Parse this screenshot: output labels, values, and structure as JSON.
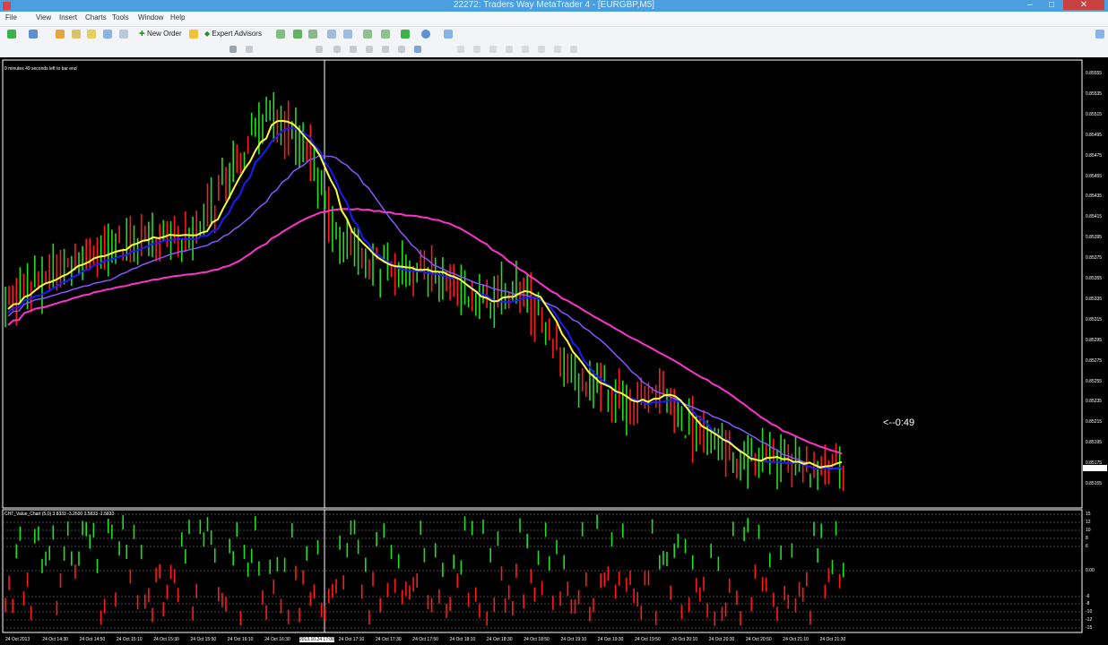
{
  "window": {
    "title": "22272: Traders Way MetaTrader 4 - [EURGBP,M5]"
  },
  "menu": [
    "File",
    "View",
    "Insert",
    "Charts",
    "Tools",
    "Window",
    "Help"
  ],
  "toolbar": {
    "new_order": "New Order",
    "expert_advisors": "Expert Advisors"
  },
  "chart": {
    "timer_text": "0 minutes 49 seconds left to bar end",
    "countdown": "<--0:49",
    "price_ticks": [
      "0.85555",
      "0.85535",
      "0.85515",
      "0.85495",
      "0.85475",
      "0.85455",
      "0.85435",
      "0.85415",
      "0.85395",
      "0.85375",
      "0.85355",
      "0.85335",
      "0.85315",
      "0.85295",
      "0.85275",
      "0.85255",
      "0.85235",
      "0.85215",
      "0.85195",
      "0.85175",
      "0.85155"
    ],
    "time_ticks": [
      "24 Oct 2013",
      "24 Oct 14:30",
      "24 Oct 14:50",
      "24 Oct 15:10",
      "24 Oct 15:30",
      "24 Oct 15:50",
      "24 Oct 16:10",
      "24 Oct 16:30",
      "2013.10.24 17:00",
      "24 Oct 17:10",
      "24 Oct 17:30",
      "24 Oct 17:50",
      "24 Oct 18:10",
      "24 Oct 18:30",
      "24 Oct 18:50",
      "24 Oct 19:10",
      "24 Oct 19:30",
      "24 Oct 19:50",
      "24 Oct 20:10",
      "24 Oct 20:30",
      "24 Oct 20:50",
      "24 Oct 21:10",
      "24 Oct 21:30"
    ],
    "colors": {
      "bull": "#22dd22",
      "bear": "#ff1a1a",
      "ema_fast": "#ffff33",
      "ema_mid": "#1a1aff",
      "ema_slow": "#8855ff",
      "ema_long": "#ff33cc"
    }
  },
  "indicator": {
    "label": "CHT_Value_Chart (5,0) 3.8333 -3.2500 2.5833 -1.5833",
    "levels": [
      "15",
      "12",
      "10",
      "8",
      "6",
      "0.00",
      "-6",
      "-8",
      "-10",
      "-12",
      "-15"
    ]
  }
}
